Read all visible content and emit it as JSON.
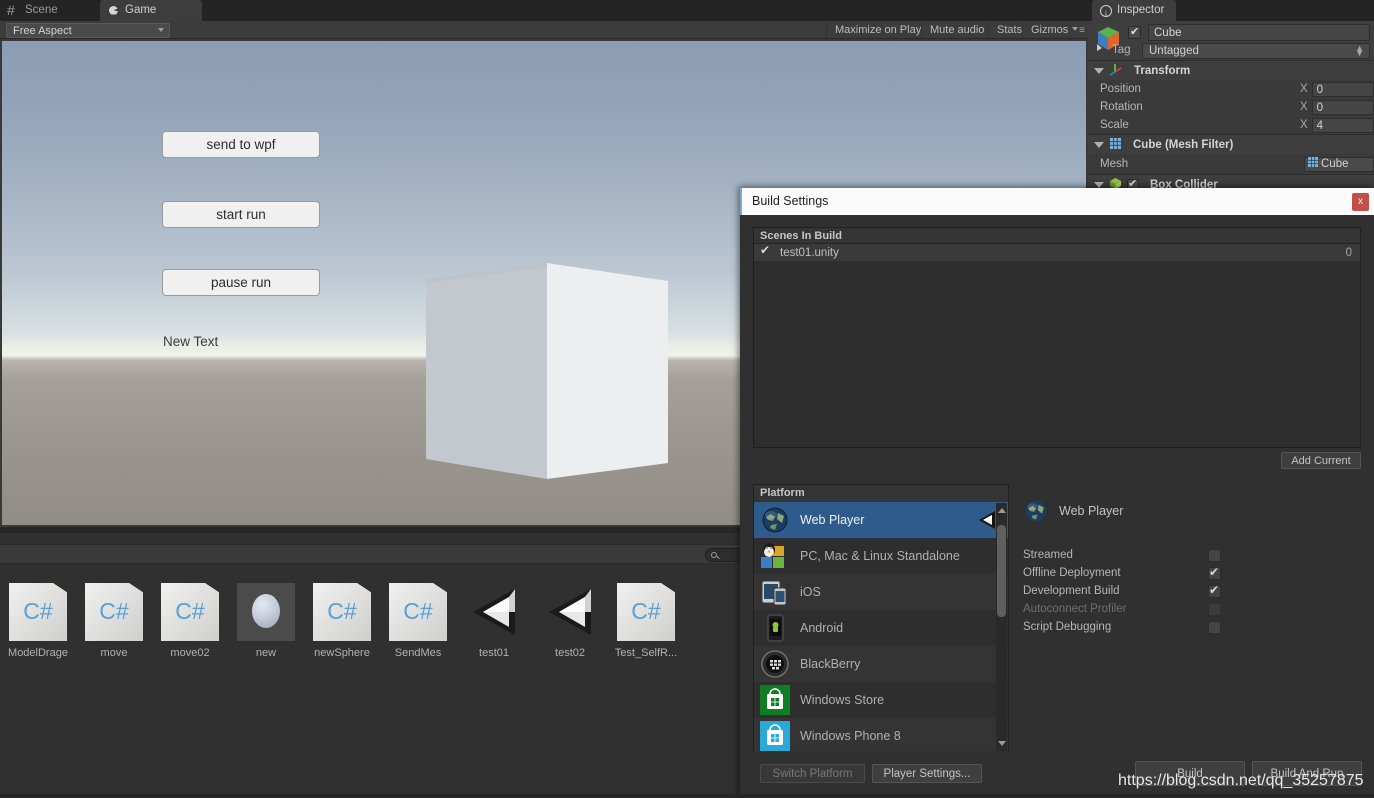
{
  "game_panel": {
    "tabs": [
      {
        "label": "Scene",
        "icon": "grid-icon",
        "active": false
      },
      {
        "label": "Game",
        "icon": "gamepad-icon",
        "active": true
      }
    ],
    "aspect": {
      "value": "Free Aspect"
    },
    "toolbar_buttons": [
      {
        "label": "Maximize on Play"
      },
      {
        "label": "Mute audio"
      },
      {
        "label": "Stats"
      },
      {
        "label": "Gizmos"
      }
    ],
    "scene_ui": {
      "buttons": [
        {
          "label": "send to wpf"
        },
        {
          "label": "start run"
        },
        {
          "label": "pause run"
        }
      ],
      "text": "New Text"
    }
  },
  "project_panel": {
    "search_placeholder": "",
    "assets": [
      {
        "label": "ModelDrage",
        "kind": "csharp-script",
        "selected": false
      },
      {
        "label": "move",
        "kind": "csharp-script",
        "selected": false
      },
      {
        "label": "move02",
        "kind": "csharp-script",
        "selected": false
      },
      {
        "label": "new",
        "kind": "material",
        "selected": true
      },
      {
        "label": "newSphere",
        "kind": "csharp-script",
        "selected": false
      },
      {
        "label": "SendMes",
        "kind": "csharp-script",
        "selected": false
      },
      {
        "label": "test01",
        "kind": "unity-scene",
        "selected": false
      },
      {
        "label": "test02",
        "kind": "unity-scene",
        "selected": false
      },
      {
        "label": "Test_SelfR...",
        "kind": "csharp-script",
        "selected": false
      }
    ]
  },
  "inspector": {
    "tab_label": "Inspector",
    "object": {
      "name": "Cube",
      "enabled": true,
      "tag_label": "Tag",
      "tag_value": "Untagged"
    },
    "components": [
      {
        "title": "Transform",
        "rows": [
          {
            "label": "Position",
            "axis": "X",
            "value": "0"
          },
          {
            "label": "Rotation",
            "axis": "X",
            "value": "0"
          },
          {
            "label": "Scale",
            "axis": "X",
            "value": "4"
          }
        ]
      },
      {
        "title": "Cube (Mesh Filter)",
        "mesh_label": "Mesh",
        "mesh_value": "Cube"
      },
      {
        "title": "Box Collider",
        "enabled": true
      }
    ]
  },
  "build_settings": {
    "title": "Build Settings",
    "close_label": "x",
    "scenes_header": "Scenes In Build",
    "scenes": [
      {
        "name": "test01.unity",
        "enabled": true,
        "index": "0"
      }
    ],
    "add_current_label": "Add Current",
    "platform_header": "Platform",
    "platforms": [
      {
        "label": "Web Player",
        "icon": "globe-icon",
        "selected": true,
        "has_unity_badge": true
      },
      {
        "label": "PC, Mac & Linux Standalone",
        "icon": "desktop-icon",
        "selected": false,
        "has_unity_badge": false
      },
      {
        "label": "iOS",
        "icon": "ipad-iphone-icon",
        "selected": false,
        "has_unity_badge": false
      },
      {
        "label": "Android",
        "icon": "android-phone-icon",
        "selected": false,
        "has_unity_badge": false
      },
      {
        "label": "BlackBerry",
        "icon": "blackberry-icon",
        "selected": false,
        "has_unity_badge": false
      },
      {
        "label": "Windows Store",
        "icon": "windows-store-icon",
        "selected": false,
        "has_unity_badge": false
      },
      {
        "label": "Windows Phone 8",
        "icon": "windows-phone-icon",
        "selected": false,
        "has_unity_badge": false
      }
    ],
    "detail": {
      "platform_name": "Web Player",
      "options": [
        {
          "label": "Streamed",
          "checked": false,
          "disabled": false
        },
        {
          "label": "Offline Deployment",
          "checked": true,
          "disabled": false
        },
        {
          "label": "Development Build",
          "checked": true,
          "disabled": false
        },
        {
          "label": "Autoconnect Profiler",
          "checked": false,
          "disabled": true
        },
        {
          "label": "Script Debugging",
          "checked": false,
          "disabled": false
        }
      ]
    },
    "footer_buttons": [
      {
        "label": "Switch Platform",
        "disabled": true
      },
      {
        "label": "Player Settings...",
        "disabled": false
      },
      {
        "label": "Build",
        "disabled": false
      },
      {
        "label": "Build And Run",
        "disabled": false
      }
    ]
  },
  "watermark": "https://blog.csdn.net/qq_35257875",
  "colors": {
    "accent_selected": "#2f5b8c",
    "close_red": "#c1504a",
    "csharp_blue": "#5a9fd4"
  }
}
